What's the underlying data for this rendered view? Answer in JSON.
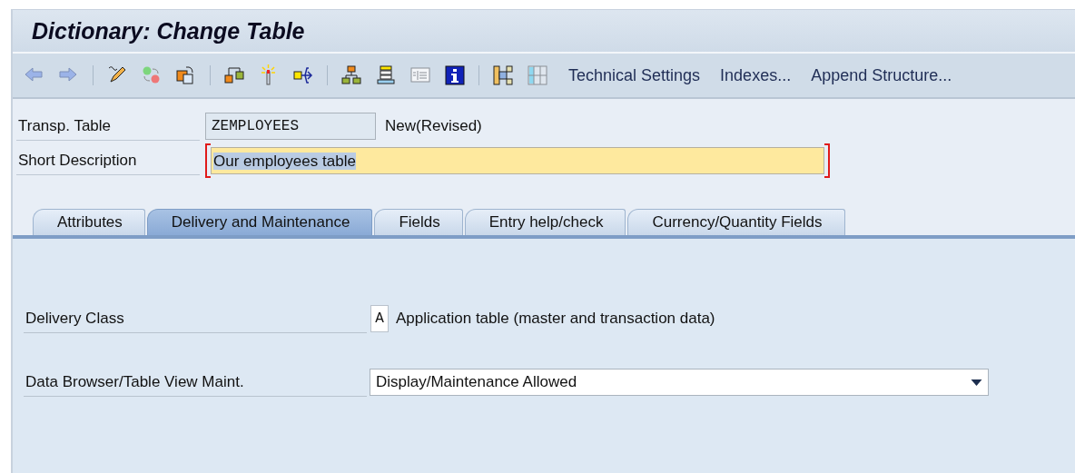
{
  "window": {
    "title": "Dictionary: Change Table"
  },
  "toolbar": {
    "text_buttons": [
      "Technical Settings",
      "Indexes...",
      "Append Structure..."
    ]
  },
  "header": {
    "fields": [
      {
        "kind": "display",
        "label": "Transp. Table",
        "value": "ZEMPLOYEES",
        "status": "New(Revised)"
      },
      {
        "kind": "input",
        "label": "Short Description",
        "value": "Our employees table",
        "text_selected": true,
        "required": true
      }
    ]
  },
  "tabs": [
    {
      "label": "Attributes",
      "selected": false
    },
    {
      "label": "Delivery and Maintenance",
      "selected": true
    },
    {
      "label": "Fields",
      "selected": false
    },
    {
      "label": "Entry help/check",
      "selected": false
    },
    {
      "label": "Currency/Quantity Fields",
      "selected": false
    }
  ],
  "panel": {
    "fields": [
      {
        "kind": "code",
        "label": "Delivery Class",
        "value": "A",
        "description": "Application table (master and transaction data)"
      },
      {
        "kind": "dropdown",
        "label": "Data Browser/Table View Maint.",
        "value": "Display/Maintenance Allowed"
      }
    ]
  }
}
